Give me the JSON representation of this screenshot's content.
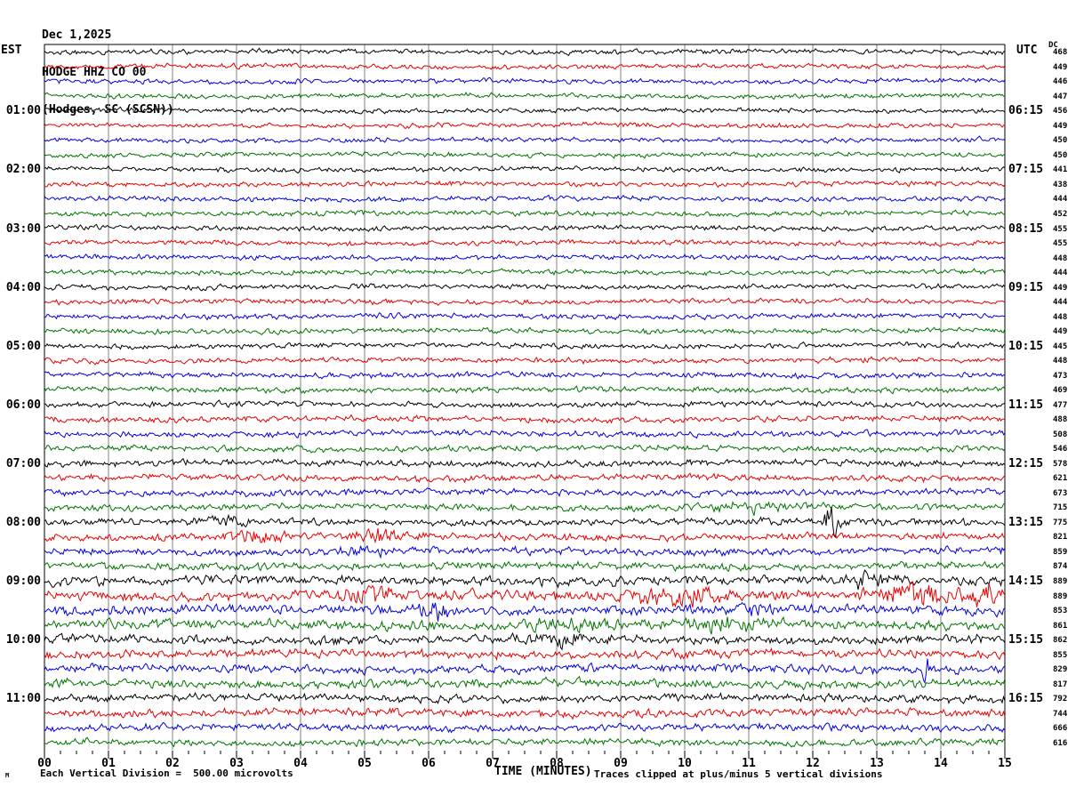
{
  "header": {
    "date": "Dec 1,2025",
    "station": "HODGE HHZ CO 00",
    "location": "(Hodges, SC (SCSN))",
    "left_tz": "EST",
    "right_tz": "UTC",
    "dc_label": "DC"
  },
  "x_axis": {
    "label": "TIME (MINUTES)",
    "minute_labels": [
      "00",
      "01",
      "02",
      "03",
      "04",
      "05",
      "06",
      "07",
      "08",
      "09",
      "10",
      "11",
      "12",
      "13",
      "14",
      "15"
    ]
  },
  "footer": {
    "mark": "M",
    "scale_note": "Each Vertical Division =  500.00 microvolts",
    "clip_note": "Traces clipped at plus/minus 5 vertical divisions"
  },
  "colors": {
    "trace_cycle": [
      "#000000",
      "#e60000",
      "#0000dd",
      "#007400"
    ],
    "grid": "#808080",
    "border": "#000000"
  },
  "chart_data": {
    "type": "line",
    "title": "HODGE HHZ CO 00 webicorder (Hodges, SC SCSN) Dec 1,2025",
    "xlabel": "TIME (MINUTES)",
    "x_range_minutes": [
      0,
      15
    ],
    "row_duration_minutes": 15,
    "traces_per_hour": 4,
    "clip_divisions": 5,
    "microvolts_per_division": 500.0,
    "rows": [
      {
        "i": 0,
        "color": "black",
        "dc": 468,
        "est": null,
        "utc": null,
        "amp": 2.2,
        "events": []
      },
      {
        "i": 1,
        "color": "red",
        "dc": 449,
        "est": null,
        "utc": null,
        "amp": 2.2,
        "events": []
      },
      {
        "i": 2,
        "color": "blue",
        "dc": 446,
        "est": null,
        "utc": null,
        "amp": 2.2,
        "events": []
      },
      {
        "i": 3,
        "color": "green",
        "dc": 447,
        "est": null,
        "utc": null,
        "amp": 2.2,
        "events": []
      },
      {
        "i": 4,
        "color": "black",
        "dc": 456,
        "est": "01:00",
        "utc": "06:15",
        "amp": 2.2,
        "events": []
      },
      {
        "i": 5,
        "color": "red",
        "dc": 449,
        "est": null,
        "utc": null,
        "amp": 2.2,
        "events": []
      },
      {
        "i": 6,
        "color": "blue",
        "dc": 450,
        "est": null,
        "utc": null,
        "amp": 2.2,
        "events": []
      },
      {
        "i": 7,
        "color": "green",
        "dc": 450,
        "est": null,
        "utc": null,
        "amp": 2.2,
        "events": []
      },
      {
        "i": 8,
        "color": "black",
        "dc": 441,
        "est": "02:00",
        "utc": "07:15",
        "amp": 2.2,
        "events": []
      },
      {
        "i": 9,
        "color": "red",
        "dc": 438,
        "est": null,
        "utc": null,
        "amp": 2.2,
        "events": []
      },
      {
        "i": 10,
        "color": "blue",
        "dc": 444,
        "est": null,
        "utc": null,
        "amp": 2.3,
        "events": []
      },
      {
        "i": 11,
        "color": "green",
        "dc": 452,
        "est": null,
        "utc": null,
        "amp": 2.3,
        "events": []
      },
      {
        "i": 12,
        "color": "black",
        "dc": 455,
        "est": "03:00",
        "utc": "08:15",
        "amp": 2.3,
        "events": []
      },
      {
        "i": 13,
        "color": "red",
        "dc": 455,
        "est": null,
        "utc": null,
        "amp": 2.3,
        "events": []
      },
      {
        "i": 14,
        "color": "blue",
        "dc": 448,
        "est": null,
        "utc": null,
        "amp": 2.3,
        "events": []
      },
      {
        "i": 15,
        "color": "green",
        "dc": 444,
        "est": null,
        "utc": null,
        "amp": 2.3,
        "events": []
      },
      {
        "i": 16,
        "color": "black",
        "dc": 449,
        "est": "04:00",
        "utc": "09:15",
        "amp": 2.4,
        "events": []
      },
      {
        "i": 17,
        "color": "red",
        "dc": 444,
        "est": null,
        "utc": null,
        "amp": 2.4,
        "events": []
      },
      {
        "i": 18,
        "color": "blue",
        "dc": 448,
        "est": null,
        "utc": null,
        "amp": 2.4,
        "events": []
      },
      {
        "i": 19,
        "color": "green",
        "dc": 449,
        "est": null,
        "utc": null,
        "amp": 2.4,
        "events": []
      },
      {
        "i": 20,
        "color": "black",
        "dc": 445,
        "est": "05:00",
        "utc": "10:15",
        "amp": 2.4,
        "events": []
      },
      {
        "i": 21,
        "color": "red",
        "dc": 448,
        "est": null,
        "utc": null,
        "amp": 2.5,
        "events": []
      },
      {
        "i": 22,
        "color": "blue",
        "dc": 473,
        "est": null,
        "utc": null,
        "amp": 2.5,
        "events": []
      },
      {
        "i": 23,
        "color": "green",
        "dc": 469,
        "est": null,
        "utc": null,
        "amp": 2.5,
        "events": []
      },
      {
        "i": 24,
        "color": "black",
        "dc": 477,
        "est": "06:00",
        "utc": "11:15",
        "amp": 2.6,
        "events": []
      },
      {
        "i": 25,
        "color": "red",
        "dc": 488,
        "est": null,
        "utc": null,
        "amp": 2.7,
        "events": []
      },
      {
        "i": 26,
        "color": "blue",
        "dc": 508,
        "est": null,
        "utc": null,
        "amp": 2.7,
        "events": []
      },
      {
        "i": 27,
        "color": "green",
        "dc": 546,
        "est": null,
        "utc": null,
        "amp": 2.8,
        "events": []
      },
      {
        "i": 28,
        "color": "black",
        "dc": 578,
        "est": "07:00",
        "utc": "12:15",
        "amp": 3.0,
        "events": []
      },
      {
        "i": 29,
        "color": "red",
        "dc": 621,
        "est": null,
        "utc": null,
        "amp": 3.0,
        "events": []
      },
      {
        "i": 30,
        "color": "blue",
        "dc": 673,
        "est": null,
        "utc": null,
        "amp": 3.0,
        "events": []
      },
      {
        "i": 31,
        "color": "green",
        "dc": 715,
        "est": null,
        "utc": null,
        "amp": 3.1,
        "events": [
          {
            "m": 11.0,
            "w": 0.5,
            "a": 1.2
          }
        ]
      },
      {
        "i": 32,
        "color": "black",
        "dc": 775,
        "est": "08:00",
        "utc": "13:15",
        "amp": 3.2,
        "events": [
          {
            "m": 2.9,
            "w": 0.25,
            "a": 1.5
          },
          {
            "m": 12.3,
            "w": 0.1,
            "a": 6
          }
        ]
      },
      {
        "i": 33,
        "color": "red",
        "dc": 821,
        "est": null,
        "utc": null,
        "amp": 3.3,
        "events": [
          {
            "m": 3.4,
            "w": 0.5,
            "a": 1.5
          },
          {
            "m": 5.1,
            "w": 0.4,
            "a": 1.3
          }
        ]
      },
      {
        "i": 34,
        "color": "blue",
        "dc": 859,
        "est": null,
        "utc": null,
        "amp": 3.4,
        "events": [
          {
            "m": 5.0,
            "w": 0.3,
            "a": 1.2
          }
        ]
      },
      {
        "i": 35,
        "color": "green",
        "dc": 874,
        "est": null,
        "utc": null,
        "amp": 3.4,
        "events": []
      },
      {
        "i": 36,
        "color": "black",
        "dc": 889,
        "est": "09:00",
        "utc": "14:15",
        "amp": 4.2,
        "events": [
          {
            "m": 12.8,
            "w": 0.3,
            "a": 1.3
          }
        ]
      },
      {
        "i": 37,
        "color": "red",
        "dc": 889,
        "est": null,
        "utc": null,
        "amp": 4.6,
        "events": [
          {
            "m": 5.0,
            "w": 0.4,
            "a": 1.5
          },
          {
            "m": 9.9,
            "w": 0.6,
            "a": 1.8
          },
          {
            "m": 13.6,
            "w": 0.4,
            "a": 2.0
          },
          {
            "m": 14.7,
            "w": 0.3,
            "a": 1.8
          }
        ]
      },
      {
        "i": 38,
        "color": "blue",
        "dc": 853,
        "est": null,
        "utc": null,
        "amp": 4.3,
        "events": [
          {
            "m": 6.1,
            "w": 0.25,
            "a": 1.6
          },
          {
            "m": 11.1,
            "w": 0.3,
            "a": 1.2
          }
        ]
      },
      {
        "i": 39,
        "color": "green",
        "dc": 861,
        "est": null,
        "utc": null,
        "amp": 4.4,
        "events": [
          {
            "m": 8.2,
            "w": 0.5,
            "a": 1.3
          },
          {
            "m": 10.6,
            "w": 0.5,
            "a": 1.4
          }
        ]
      },
      {
        "i": 40,
        "color": "black",
        "dc": 862,
        "est": "10:00",
        "utc": "15:15",
        "amp": 4.0,
        "events": [
          {
            "m": 8.0,
            "w": 0.4,
            "a": 1.2
          }
        ]
      },
      {
        "i": 41,
        "color": "red",
        "dc": 855,
        "est": null,
        "utc": null,
        "amp": 3.9,
        "events": []
      },
      {
        "i": 42,
        "color": "blue",
        "dc": 829,
        "est": null,
        "utc": null,
        "amp": 3.9,
        "events": [
          {
            "m": 13.75,
            "w": 0.05,
            "a": 7
          }
        ]
      },
      {
        "i": 43,
        "color": "green",
        "dc": 817,
        "est": null,
        "utc": null,
        "amp": 3.9,
        "events": []
      },
      {
        "i": 44,
        "color": "black",
        "dc": 792,
        "est": "11:00",
        "utc": "16:15",
        "amp": 3.7,
        "events": []
      },
      {
        "i": 45,
        "color": "red",
        "dc": 744,
        "est": null,
        "utc": null,
        "amp": 3.6,
        "events": []
      },
      {
        "i": 46,
        "color": "blue",
        "dc": 666,
        "est": null,
        "utc": null,
        "amp": 3.2,
        "events": []
      },
      {
        "i": 47,
        "color": "green",
        "dc": 616,
        "est": null,
        "utc": null,
        "amp": 3.0,
        "events": []
      }
    ]
  }
}
